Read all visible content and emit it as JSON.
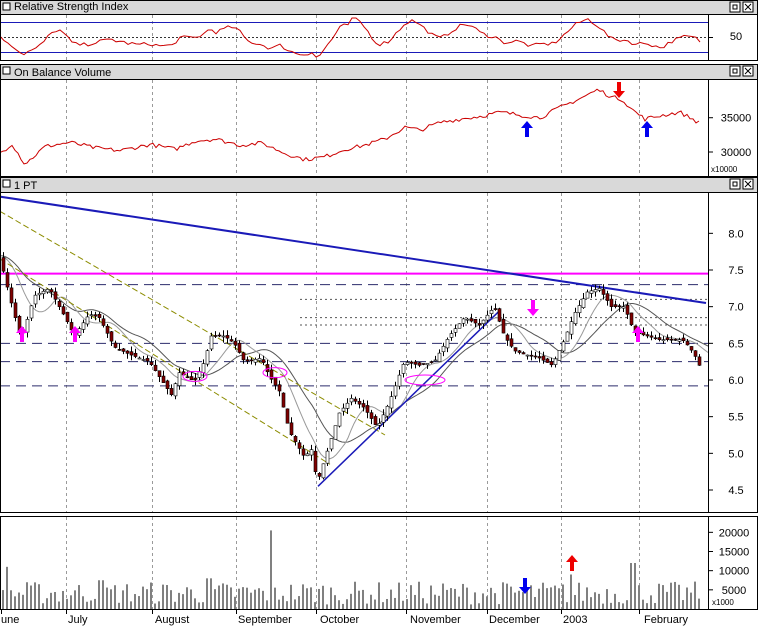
{
  "panels": {
    "rsi": {
      "title": "Relative Strength Index",
      "tick_label": "50"
    },
    "obv": {
      "title": "On Balance Volume",
      "unit_label": "x10000"
    },
    "price": {
      "title": "1 PT"
    },
    "volume": {
      "unit_label": "x1000"
    }
  },
  "colors": {
    "panel_bg": "#ffffff",
    "title_bar": "#d9d9d9",
    "frame": "#000000",
    "rsi_line": "#cc0000",
    "obv_line": "#cc0000",
    "trend_blue": "#1a1ab8",
    "resistance_magenta": "#ff00ff",
    "channel_olive": "#8c8c00",
    "arrow_blue": "#0000ee",
    "arrow_red": "#ee0000",
    "arrow_magenta": "#ff00ff",
    "candle_up": "#ffffff",
    "candle_down": "#800000",
    "volume_bar": "#808080"
  },
  "chart_data": [
    {
      "type": "line",
      "panel": "rsi",
      "title": "Relative Strength Index",
      "yticks": [
        50
      ],
      "reference_levels": [
        70,
        50,
        30
      ],
      "ylim": [
        20,
        80
      ]
    },
    {
      "type": "line",
      "panel": "obv",
      "title": "On Balance Volume",
      "yticks": [
        35000,
        30000
      ],
      "unit": "x10000",
      "ylim": [
        26500,
        40500
      ],
      "arrows": [
        {
          "direction": "up",
          "color": "blue",
          "month": "December"
        },
        {
          "direction": "down",
          "color": "red",
          "month": "2003"
        },
        {
          "direction": "up",
          "color": "blue",
          "month": "February"
        }
      ]
    },
    {
      "type": "candlestick",
      "panel": "price",
      "title": "1 PT",
      "yticks": [
        8.0,
        7.5,
        7.0,
        6.5,
        6.0,
        5.5,
        5.0,
        4.5
      ],
      "ylim": [
        4.2,
        8.55
      ],
      "x_labels": [
        "une",
        "July",
        "August",
        "September",
        "October",
        "November",
        "December",
        "2003",
        "February"
      ],
      "resistance_level": 7.45,
      "dashed_levels": [
        7.3,
        6.5,
        6.25,
        5.92
      ],
      "dotted_levels": [
        7.1,
        6.85,
        6.75
      ],
      "price_path": [
        [
          0,
          7.7
        ],
        [
          12,
          7.05
        ],
        [
          22,
          6.55
        ],
        [
          35,
          7.15
        ],
        [
          50,
          7.25
        ],
        [
          66,
          6.85
        ],
        [
          75,
          6.6
        ],
        [
          90,
          6.9
        ],
        [
          100,
          6.85
        ],
        [
          115,
          6.45
        ],
        [
          130,
          6.35
        ],
        [
          150,
          6.25
        ],
        [
          172,
          5.8
        ],
        [
          180,
          6.1
        ],
        [
          195,
          5.98
        ],
        [
          205,
          6.25
        ],
        [
          212,
          6.6
        ],
        [
          225,
          6.6
        ],
        [
          235,
          6.5
        ],
        [
          245,
          6.25
        ],
        [
          262,
          6.3
        ],
        [
          270,
          6.05
        ],
        [
          280,
          5.85
        ],
        [
          290,
          5.3
        ],
        [
          305,
          4.95
        ],
        [
          312,
          5.05
        ],
        [
          318,
          4.6
        ],
        [
          325,
          4.9
        ],
        [
          340,
          5.55
        ],
        [
          352,
          5.75
        ],
        [
          365,
          5.62
        ],
        [
          378,
          5.35
        ],
        [
          390,
          5.7
        ],
        [
          405,
          6.25
        ],
        [
          420,
          6.2
        ],
        [
          435,
          6.25
        ],
        [
          450,
          6.6
        ],
        [
          465,
          6.85
        ],
        [
          480,
          6.75
        ],
        [
          495,
          7.0
        ],
        [
          505,
          6.6
        ],
        [
          515,
          6.4
        ],
        [
          525,
          6.35
        ],
        [
          540,
          6.3
        ],
        [
          553,
          6.2
        ],
        [
          565,
          6.55
        ],
        [
          575,
          6.9
        ],
        [
          588,
          7.2
        ],
        [
          600,
          7.25
        ],
        [
          612,
          7.0
        ],
        [
          625,
          7.0
        ],
        [
          635,
          6.65
        ],
        [
          648,
          6.6
        ],
        [
          660,
          6.55
        ],
        [
          672,
          6.55
        ],
        [
          683,
          6.55
        ],
        [
          690,
          6.45
        ],
        [
          697,
          6.3
        ],
        [
          700,
          6.2
        ]
      ],
      "arrows": [
        {
          "direction": "up",
          "color": "magenta",
          "month": "June"
        },
        {
          "direction": "up",
          "color": "magenta",
          "month": "July"
        },
        {
          "direction": "down",
          "color": "magenta",
          "month": "December"
        },
        {
          "direction": "up",
          "color": "magenta",
          "month": "February"
        }
      ]
    },
    {
      "type": "bar",
      "panel": "volume",
      "yticks": [
        20000,
        15000,
        10000,
        5000
      ],
      "unit": "x1000",
      "ylim": [
        0,
        24000
      ],
      "arrows": [
        {
          "direction": "down",
          "color": "blue",
          "month": "December"
        },
        {
          "direction": "up",
          "color": "red",
          "month": "2003"
        }
      ]
    }
  ]
}
